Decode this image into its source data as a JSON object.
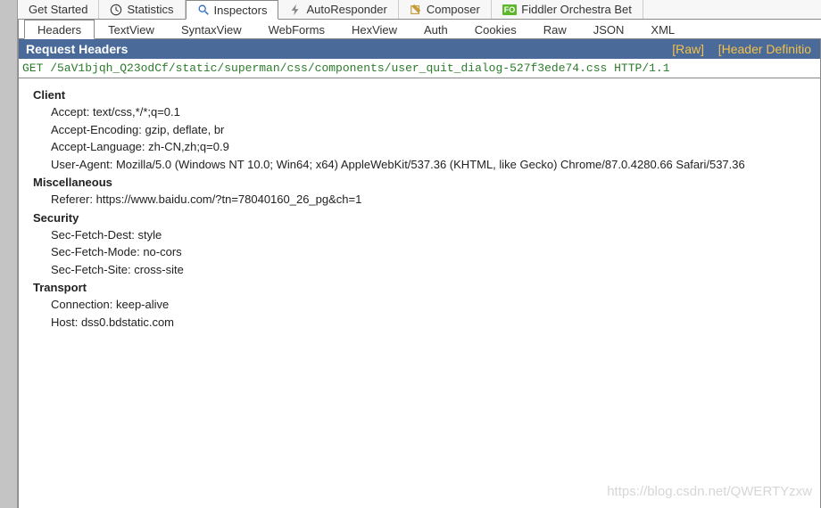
{
  "topTabs": {
    "getStarted": "Get Started",
    "statistics": "Statistics",
    "inspectors": "Inspectors",
    "autoResponder": "AutoResponder",
    "composer": "Composer",
    "orchestra": "Fiddler Orchestra Bet"
  },
  "subTabs": {
    "headers": "Headers",
    "textView": "TextView",
    "syntaxView": "SyntaxView",
    "webForms": "WebForms",
    "hexView": "HexView",
    "auth": "Auth",
    "cookies": "Cookies",
    "raw": "Raw",
    "json": "JSON",
    "xml": "XML"
  },
  "sectionTitle": "Request Headers",
  "linkRaw": "[Raw]",
  "linkDef": "[Header Definitio",
  "requestLine": "GET /5aV1bjqh_Q23odCf/static/superman/css/components/user_quit_dialog-527f3ede74.css HTTP/1.1",
  "groups": {
    "client": {
      "title": "Client",
      "accept": "Accept: text/css,*/*;q=0.1",
      "acceptEncoding": "Accept-Encoding: gzip, deflate, br",
      "acceptLanguage": "Accept-Language: zh-CN,zh;q=0.9",
      "userAgent": "User-Agent: Mozilla/5.0 (Windows NT 10.0; Win64; x64) AppleWebKit/537.36 (KHTML, like Gecko) Chrome/87.0.4280.66 Safari/537.36"
    },
    "misc": {
      "title": "Miscellaneous",
      "referer": "Referer: https://www.baidu.com/?tn=78040160_26_pg&ch=1"
    },
    "security": {
      "title": "Security",
      "dest": "Sec-Fetch-Dest: style",
      "mode": "Sec-Fetch-Mode: no-cors",
      "site": "Sec-Fetch-Site: cross-site"
    },
    "transport": {
      "title": "Transport",
      "connection": "Connection: keep-alive",
      "host": "Host: dss0.bdstatic.com"
    }
  },
  "watermark": "https://blog.csdn.net/QWERTYzxw"
}
